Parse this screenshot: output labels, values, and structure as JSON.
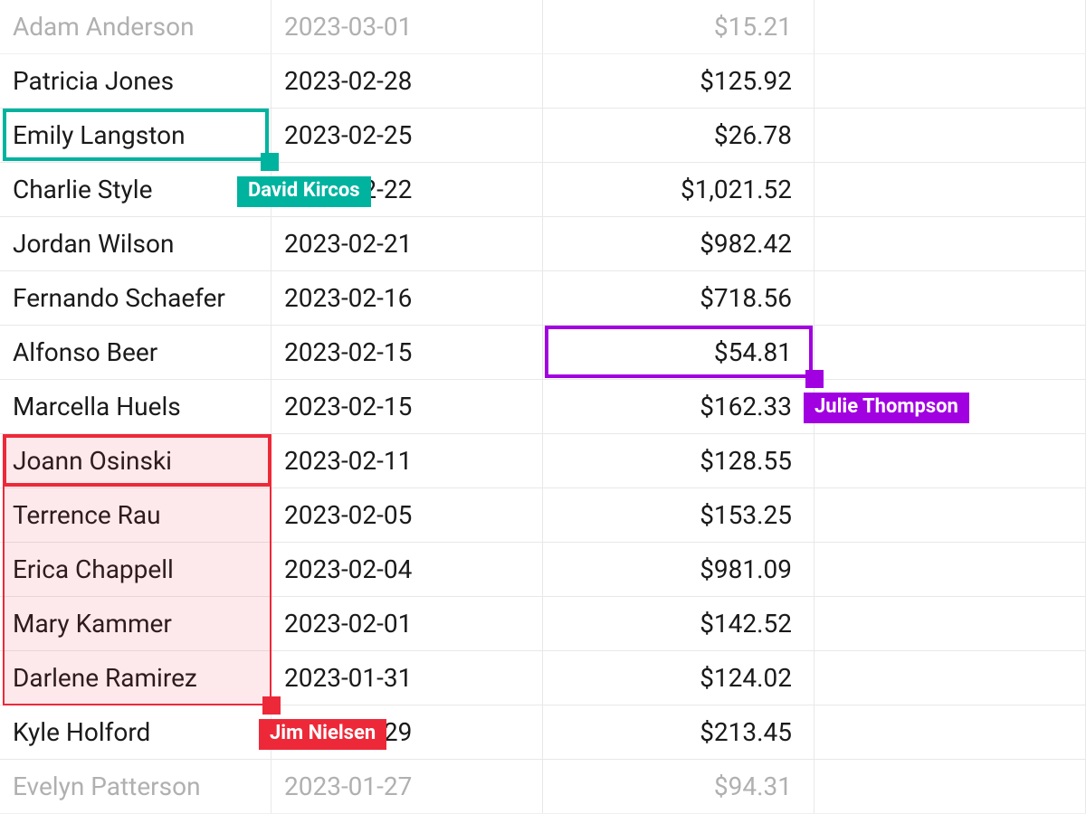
{
  "rows": [
    {
      "name": "Adam Anderson",
      "date": "2023-03-01",
      "amount": "$15.21",
      "faded": true
    },
    {
      "name": "Patricia Jones",
      "date": "2023-02-28",
      "amount": "$125.92",
      "faded": false
    },
    {
      "name": "Emily Langston",
      "date": "2023-02-25",
      "amount": "$26.78",
      "faded": false
    },
    {
      "name": "Charlie Style",
      "date": "2023-02-22",
      "amount": "$1,021.52",
      "faded": false
    },
    {
      "name": "Jordan Wilson",
      "date": "2023-02-21",
      "amount": "$982.42",
      "faded": false
    },
    {
      "name": "Fernando Schaefer",
      "date": "2023-02-16",
      "amount": "$718.56",
      "faded": false
    },
    {
      "name": "Alfonso Beer",
      "date": "2023-02-15",
      "amount": "$54.81",
      "faded": false
    },
    {
      "name": "Marcella Huels",
      "date": "2023-02-15",
      "amount": "$162.33",
      "faded": false
    },
    {
      "name": "Joann Osinski",
      "date": "2023-02-11",
      "amount": "$128.55",
      "faded": false
    },
    {
      "name": "Terrence Rau",
      "date": "2023-02-05",
      "amount": "$153.25",
      "faded": false
    },
    {
      "name": "Erica Chappell",
      "date": "2023-02-04",
      "amount": "$981.09",
      "faded": false
    },
    {
      "name": "Mary Kammer",
      "date": "2023-02-01",
      "amount": "$142.52",
      "faded": false
    },
    {
      "name": "Darlene Ramirez",
      "date": "2023-01-31",
      "amount": "$124.02",
      "faded": false
    },
    {
      "name": "Kyle Holford",
      "date": "2023-01-29",
      "amount": "$213.45",
      "faded": false
    },
    {
      "name": "Evelyn Patterson",
      "date": "2023-01-27",
      "amount": "$94.31",
      "faded": true
    }
  ],
  "cursors": {
    "david": {
      "label": "David Kircos",
      "color": "#00b39f"
    },
    "julie": {
      "label": "Julie Thompson",
      "color": "#a100e0"
    },
    "jim": {
      "label": "Jim Nielsen",
      "color": "#ed2939"
    }
  }
}
